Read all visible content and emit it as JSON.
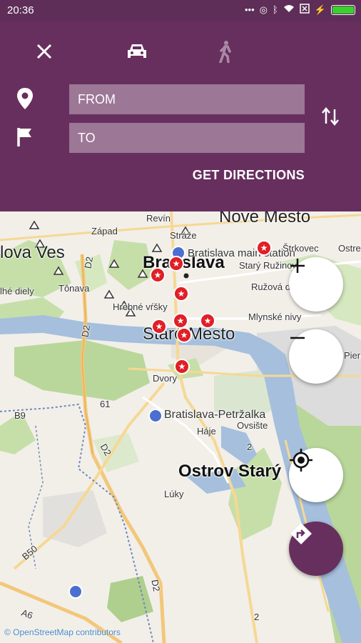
{
  "status_bar": {
    "time": "20:36",
    "icons": [
      "more-dots-icon",
      "hotspot-icon",
      "bluetooth-icon",
      "wifi-icon",
      "sim-off-icon",
      "charging-icon",
      "battery-icon"
    ],
    "battery_level": 1.0,
    "battery_color": "#3ad12f"
  },
  "toolbar": {
    "close_icon": "close-icon",
    "modes": [
      {
        "name": "car-mode",
        "icon": "car-icon",
        "selected": true
      },
      {
        "name": "walk-mode",
        "icon": "walk-icon",
        "selected": false
      }
    ]
  },
  "route_form": {
    "from_placeholder": "FROM",
    "to_placeholder": "TO",
    "from_icon": "location-pin-icon",
    "to_icon": "flag-icon",
    "swap_icon": "swap-vertical-icon",
    "get_directions_label": "GET DIRECTIONS"
  },
  "colors": {
    "primary": "#672f5e",
    "status_bar": "#5e2d58",
    "poi_red": "#e01f26",
    "river": "#a5bfdd",
    "park": "#c6dfa9"
  },
  "map": {
    "labels": {
      "nove_mesto": "Nové Mesto",
      "dlha_ves": "lova Ves",
      "bratislava": "Bratislava",
      "bratislava_main_station": "Bratislava main station",
      "stary_mesto": "Staré Mesto",
      "petrzalka": "Bratislava-Petržalka",
      "ostrov_stary": "Ostrov Starý",
      "revin": "Revín",
      "zapad": "Západ",
      "straze": "Stráže",
      "stary_ruzinov": "Starý Ružinov",
      "strkovec": "Štrkovec",
      "ostre": "Ostre",
      "ruzova": "Ružová d",
      "mlynske_nivy": "Mlynské nivy",
      "tonava": "Tônava",
      "hrebne": "Hrebné vŕšky",
      "dlhe_diely": "lhé diely",
      "dvory": "Dvory",
      "haje": "Háje",
      "ovsiste": "Ovsište",
      "luky": "Lúky",
      "pierr": "Pierr",
      "road_d2_a": "D2",
      "road_d2_b": "D2",
      "road_d2_c": "D2",
      "road_d2_d": "D2",
      "road_61": "61",
      "road_b9": "B9",
      "road_b50": "B50",
      "road_a6": "A6",
      "road_2a": "2",
      "road_2b": "2"
    },
    "poi_markers": 11,
    "attribution": "© OpenStreetMap contributors"
  },
  "controls": {
    "zoom_in_icon": "plus-icon",
    "zoom_out_icon": "minus-icon",
    "my_location_icon": "crosshair-location-icon",
    "navigate_icon": "turn-right-icon"
  }
}
